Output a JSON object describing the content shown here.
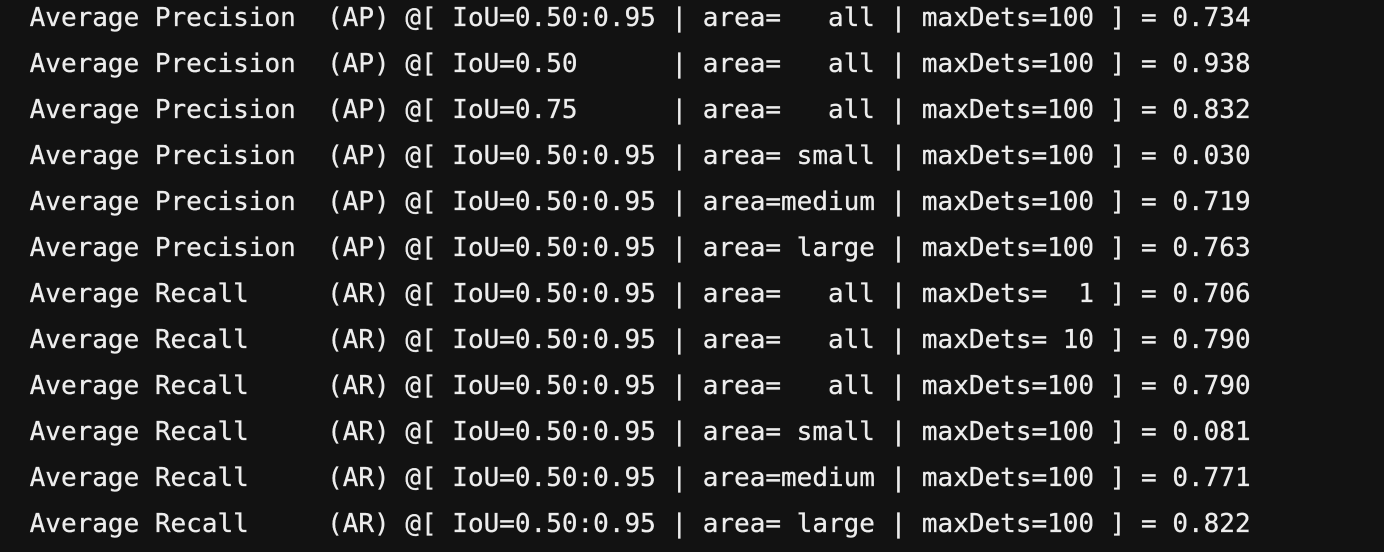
{
  "terminal": {
    "background": "#121212",
    "text_color": "#ededed",
    "lines": [
      " Average Precision  (AP) @[ IoU=0.50:0.95 | area=   all | maxDets=100 ] = 0.734",
      " Average Precision  (AP) @[ IoU=0.50      | area=   all | maxDets=100 ] = 0.938",
      " Average Precision  (AP) @[ IoU=0.75      | area=   all | maxDets=100 ] = 0.832",
      " Average Precision  (AP) @[ IoU=0.50:0.95 | area= small | maxDets=100 ] = 0.030",
      " Average Precision  (AP) @[ IoU=0.50:0.95 | area=medium | maxDets=100 ] = 0.719",
      " Average Precision  (AP) @[ IoU=0.50:0.95 | area= large | maxDets=100 ] = 0.763",
      " Average Recall     (AR) @[ IoU=0.50:0.95 | area=   all | maxDets=  1 ] = 0.706",
      " Average Recall     (AR) @[ IoU=0.50:0.95 | area=   all | maxDets= 10 ] = 0.790",
      " Average Recall     (AR) @[ IoU=0.50:0.95 | area=   all | maxDets=100 ] = 0.790",
      " Average Recall     (AR) @[ IoU=0.50:0.95 | area= small | maxDets=100 ] = 0.081",
      " Average Recall     (AR) @[ IoU=0.50:0.95 | area=medium | maxDets=100 ] = 0.771",
      " Average Recall     (AR) @[ IoU=0.50:0.95 | area= large | maxDets=100 ] = 0.822"
    ]
  }
}
